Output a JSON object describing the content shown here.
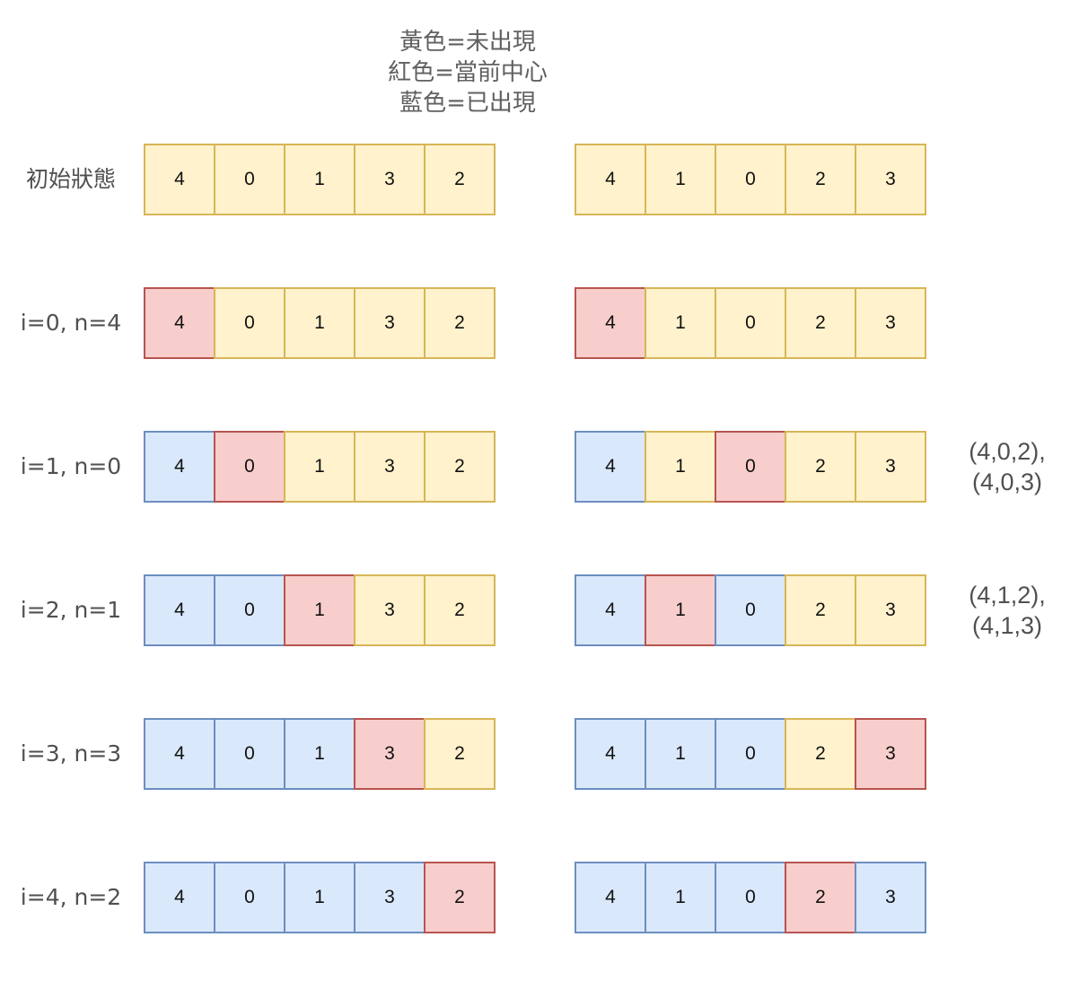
{
  "legend": [
    "黃色=未出現",
    "紅色=當前中心",
    "藍色=已出現"
  ],
  "colors": {
    "yellow": {
      "fill": "#fff2cc",
      "stroke": "#d6b656"
    },
    "red": {
      "fill": "#f8cecc",
      "stroke": "#b85450"
    },
    "blue": {
      "fill": "#dae8fc",
      "stroke": "#6c8ebf"
    }
  },
  "rows": [
    {
      "label": "初始狀態",
      "left": [
        {
          "v": "4",
          "c": "yellow"
        },
        {
          "v": "0",
          "c": "yellow"
        },
        {
          "v": "1",
          "c": "yellow"
        },
        {
          "v": "3",
          "c": "yellow"
        },
        {
          "v": "2",
          "c": "yellow"
        }
      ],
      "right": [
        {
          "v": "4",
          "c": "yellow"
        },
        {
          "v": "1",
          "c": "yellow"
        },
        {
          "v": "0",
          "c": "yellow"
        },
        {
          "v": "2",
          "c": "yellow"
        },
        {
          "v": "3",
          "c": "yellow"
        }
      ],
      "note": []
    },
    {
      "label": "i=0, n=4",
      "left": [
        {
          "v": "4",
          "c": "red"
        },
        {
          "v": "0",
          "c": "yellow"
        },
        {
          "v": "1",
          "c": "yellow"
        },
        {
          "v": "3",
          "c": "yellow"
        },
        {
          "v": "2",
          "c": "yellow"
        }
      ],
      "right": [
        {
          "v": "4",
          "c": "red"
        },
        {
          "v": "1",
          "c": "yellow"
        },
        {
          "v": "0",
          "c": "yellow"
        },
        {
          "v": "2",
          "c": "yellow"
        },
        {
          "v": "3",
          "c": "yellow"
        }
      ],
      "note": []
    },
    {
      "label": "i=1, n=0",
      "left": [
        {
          "v": "4",
          "c": "blue"
        },
        {
          "v": "0",
          "c": "red"
        },
        {
          "v": "1",
          "c": "yellow"
        },
        {
          "v": "3",
          "c": "yellow"
        },
        {
          "v": "2",
          "c": "yellow"
        }
      ],
      "right": [
        {
          "v": "4",
          "c": "blue"
        },
        {
          "v": "1",
          "c": "yellow"
        },
        {
          "v": "0",
          "c": "red"
        },
        {
          "v": "2",
          "c": "yellow"
        },
        {
          "v": "3",
          "c": "yellow"
        }
      ],
      "note": [
        "(4,0,2),",
        "(4,0,3)"
      ]
    },
    {
      "label": "i=2, n=1",
      "left": [
        {
          "v": "4",
          "c": "blue"
        },
        {
          "v": "0",
          "c": "blue"
        },
        {
          "v": "1",
          "c": "red"
        },
        {
          "v": "3",
          "c": "yellow"
        },
        {
          "v": "2",
          "c": "yellow"
        }
      ],
      "right": [
        {
          "v": "4",
          "c": "blue"
        },
        {
          "v": "1",
          "c": "red"
        },
        {
          "v": "0",
          "c": "blue"
        },
        {
          "v": "2",
          "c": "yellow"
        },
        {
          "v": "3",
          "c": "yellow"
        }
      ],
      "note": [
        "(4,1,2),",
        "(4,1,3)"
      ]
    },
    {
      "label": "i=3, n=3",
      "left": [
        {
          "v": "4",
          "c": "blue"
        },
        {
          "v": "0",
          "c": "blue"
        },
        {
          "v": "1",
          "c": "blue"
        },
        {
          "v": "3",
          "c": "red"
        },
        {
          "v": "2",
          "c": "yellow"
        }
      ],
      "right": [
        {
          "v": "4",
          "c": "blue"
        },
        {
          "v": "1",
          "c": "blue"
        },
        {
          "v": "0",
          "c": "blue"
        },
        {
          "v": "2",
          "c": "yellow"
        },
        {
          "v": "3",
          "c": "red"
        }
      ],
      "note": []
    },
    {
      "label": "i=4, n=2",
      "left": [
        {
          "v": "4",
          "c": "blue"
        },
        {
          "v": "0",
          "c": "blue"
        },
        {
          "v": "1",
          "c": "blue"
        },
        {
          "v": "3",
          "c": "blue"
        },
        {
          "v": "2",
          "c": "red"
        }
      ],
      "right": [
        {
          "v": "4",
          "c": "blue"
        },
        {
          "v": "1",
          "c": "blue"
        },
        {
          "v": "0",
          "c": "blue"
        },
        {
          "v": "2",
          "c": "red"
        },
        {
          "v": "3",
          "c": "blue"
        }
      ],
      "note": []
    }
  ]
}
